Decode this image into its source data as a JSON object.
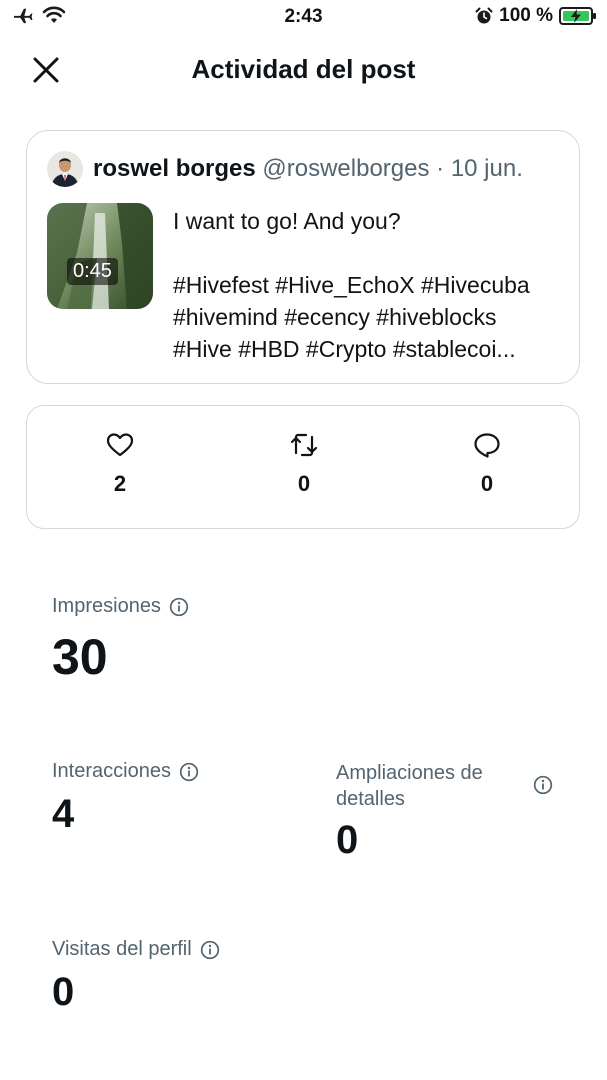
{
  "status_bar": {
    "time": "2:43",
    "battery": "100 %"
  },
  "header": {
    "title": "Actividad del post"
  },
  "post": {
    "name": "roswel borges",
    "meta": "@roswelborges · 10 jun.",
    "duration": "0:45",
    "lines": [
      "I want to go! And you?",
      "",
      "#Hivefest #Hive_EchoX #Hivecuba",
      "#hivemind #ecency #hiveblocks",
      "#Hive #HBD #Crypto #stablecoi..."
    ]
  },
  "engagement": {
    "likes": "2",
    "reposts": "0",
    "replies": "0"
  },
  "metrics": {
    "impressions": {
      "label": "Impresiones",
      "value": "30"
    },
    "interactions": {
      "label": "Interacciones",
      "value": "4"
    },
    "expansions": {
      "label_line1": "Ampliaciones de",
      "label_line2": "detalles",
      "value": "0"
    },
    "profile_visits": {
      "label": "Visitas del perfil",
      "value": "0"
    }
  },
  "colors": {
    "text": "#0f1419",
    "secondary": "#536471",
    "border": "#cfd9de",
    "battery": "#34c759"
  },
  "icons": [
    "airplane-icon",
    "wifi-icon",
    "alarm-icon",
    "battery-icon",
    "close-icon",
    "heart-icon",
    "repost-icon",
    "reply-icon",
    "info-icon"
  ]
}
